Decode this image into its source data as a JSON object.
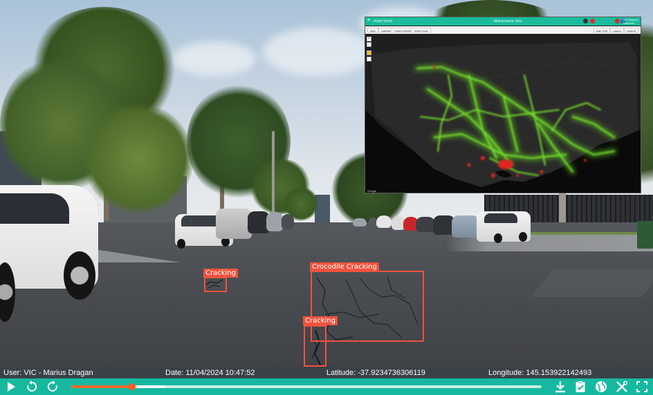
{
  "detections": [
    {
      "label": "Cracking"
    },
    {
      "label": "Crocodile Cracking"
    },
    {
      "label": "Cracking"
    }
  ],
  "info_bar": {
    "user": "User: VIC - Marius Dragan",
    "date": "Date: 11/04/2024 10:47:52",
    "latitude": "Latitude: -37.9234736306119",
    "longitude": "Longitude: 145.153922142493"
  },
  "playback": {
    "progress_fraction": 0.13,
    "buffered_fraction": 0.2,
    "buttons": [
      "play-icon",
      "rewind-icon",
      "forward-icon",
      "download-icon",
      "clipboard-check-icon",
      "globe-icon",
      "tools-icon",
      "fullscreen-icon"
    ]
  },
  "map_panel": {
    "brand": "Asset Vision",
    "title": "Maintenance Jobs",
    "tabs": [
      "Map",
      "Satellite",
      "Search Address",
      "Select Jobs"
    ],
    "right_tabs": [
      "Map Grid",
      "Layers",
      "Legend"
    ],
    "user_name": "VIC Support",
    "user_org": "Dashcam",
    "zoom_in": "+",
    "zoom_out": "−",
    "attribution": "Google"
  },
  "colors": {
    "accent": "#16b9a0",
    "detection": "#f0523e",
    "progress": "#ff6a2b",
    "info_bar": "#3a4149",
    "heat_low": "#6fd72a",
    "heat_high": "#e0281c"
  }
}
